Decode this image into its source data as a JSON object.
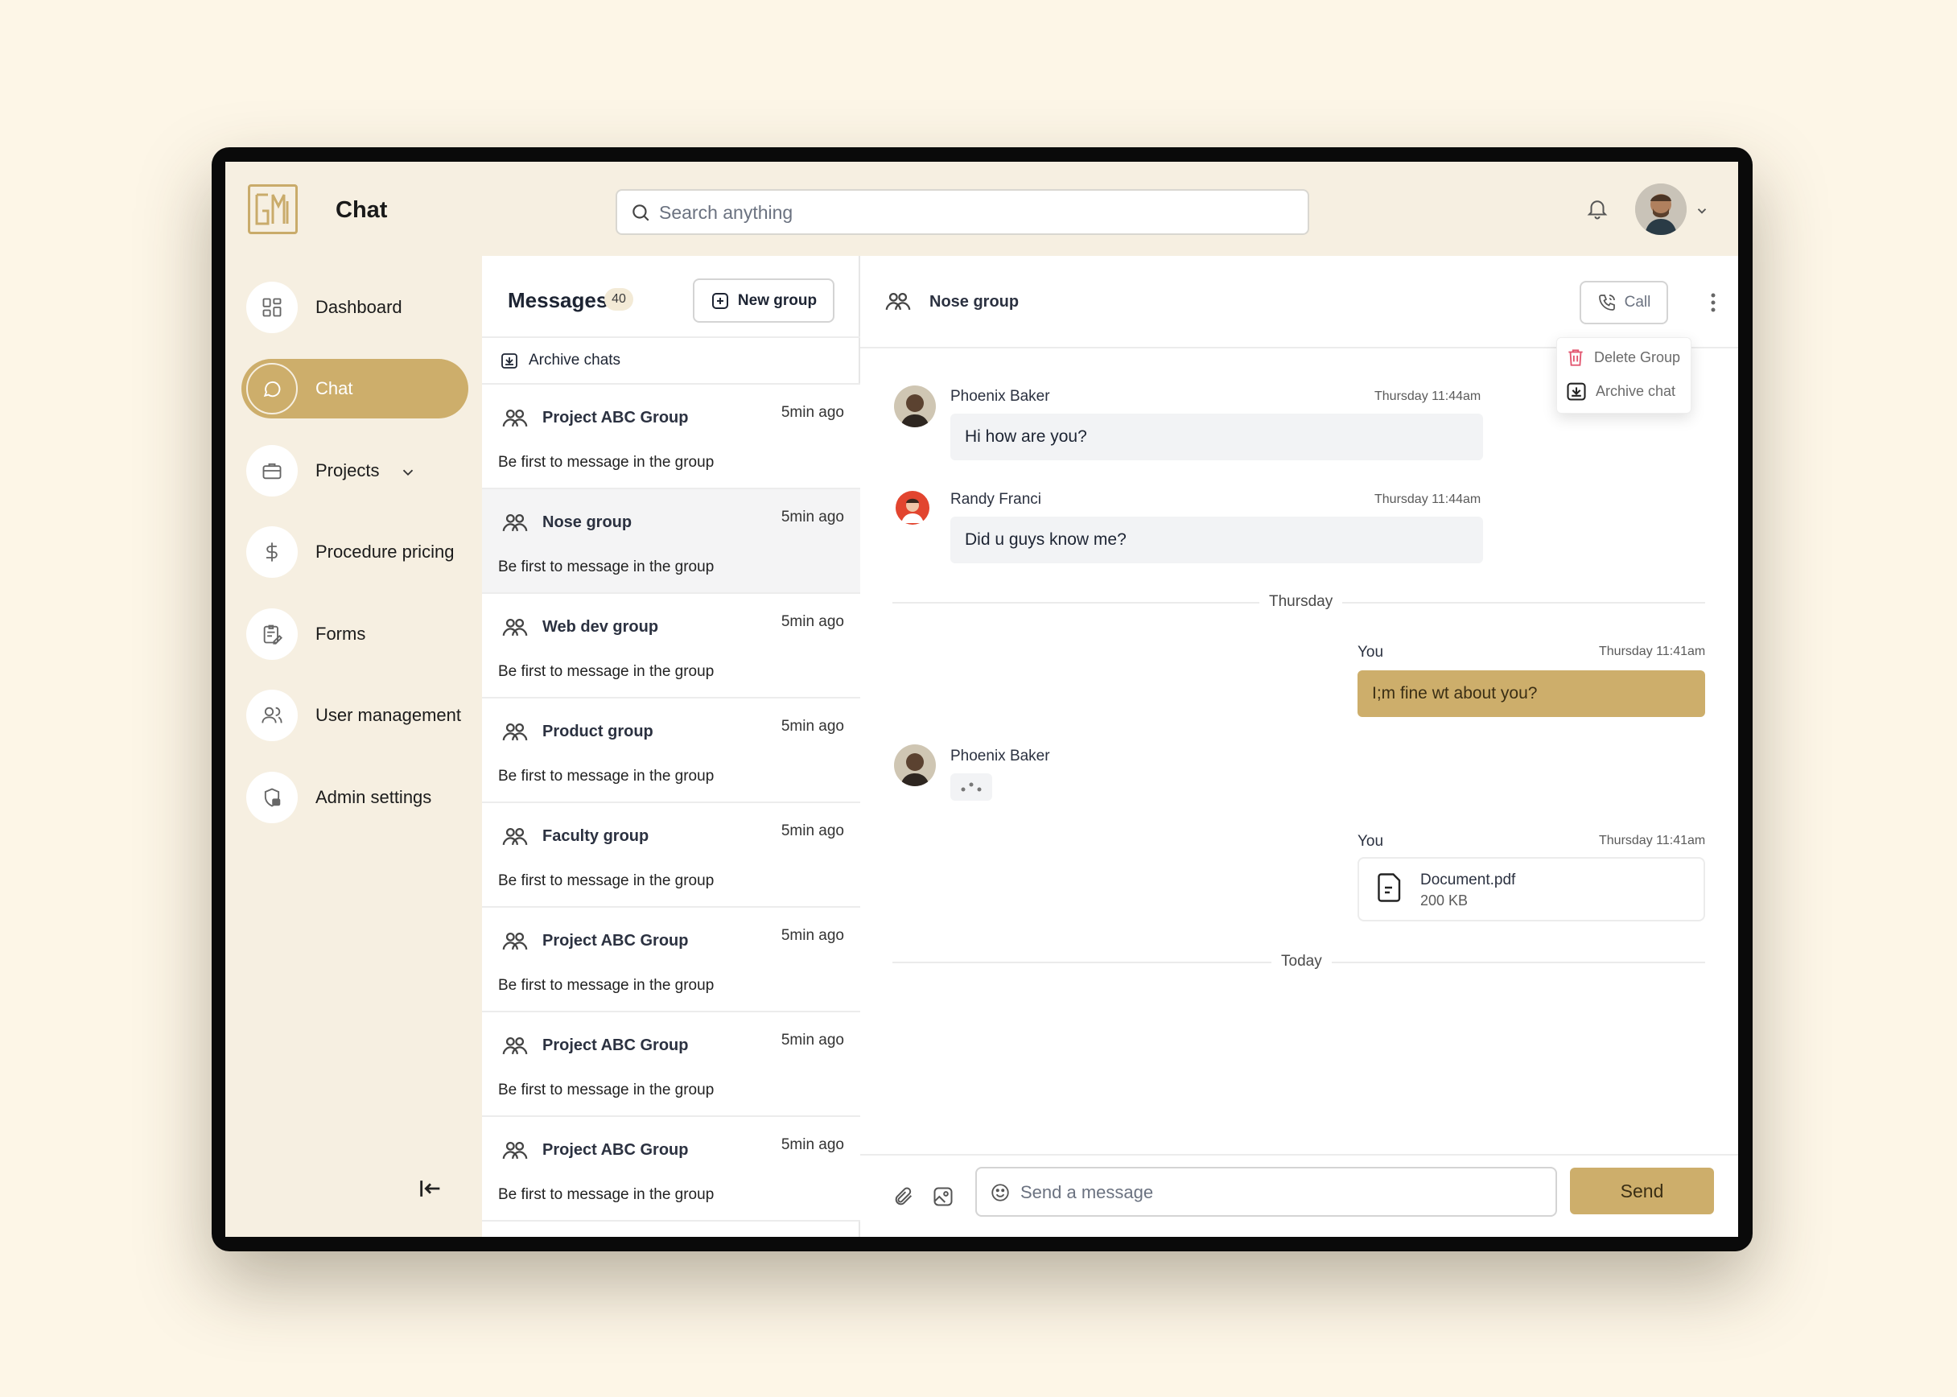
{
  "header": {
    "app_title": "Chat",
    "search_placeholder": "Search anything"
  },
  "sidebar": {
    "items": [
      {
        "label": "Dashboard",
        "icon": "grid-icon"
      },
      {
        "label": "Chat",
        "icon": "chat-bubble-icon",
        "active": true
      },
      {
        "label": "Projects",
        "icon": "briefcase-icon"
      },
      {
        "label": "Procedure pricing",
        "icon": "dollar-icon"
      },
      {
        "label": "Forms",
        "icon": "clipboard-icon"
      },
      {
        "label": "User management",
        "icon": "users-icon"
      },
      {
        "label": "Admin settings",
        "icon": "shield-lock-icon"
      }
    ]
  },
  "messages_panel": {
    "title": "Messages",
    "count": "40",
    "new_group_label": "New group",
    "archive_label": "Archive chats",
    "conversations": [
      {
        "name": "Project ABC Group",
        "time": "5min ago",
        "preview": "Be first to message in the group"
      },
      {
        "name": "Nose group",
        "time": "5min ago",
        "preview": "Be first to message in the group",
        "selected": true
      },
      {
        "name": "Web dev group",
        "time": "5min ago",
        "preview": "Be first to message in the group"
      },
      {
        "name": "Product group",
        "time": "5min ago",
        "preview": "Be first to message in the group"
      },
      {
        "name": "Faculty group",
        "time": "5min ago",
        "preview": "Be first to message in the group"
      },
      {
        "name": "Project ABC Group",
        "time": "5min ago",
        "preview": "Be first to message in the group"
      },
      {
        "name": "Project ABC Group",
        "time": "5min ago",
        "preview": "Be first to message in the group"
      },
      {
        "name": "Project ABC Group",
        "time": "5min ago",
        "preview": "Be first to message in the group"
      }
    ]
  },
  "chat": {
    "group_name": "Nose group",
    "call_label": "Call",
    "menu": {
      "delete_label": "Delete Group",
      "archive_label": "Archive chat"
    },
    "messages": [
      {
        "sender": "Phoenix Baker",
        "time": "Thursday 11:44am",
        "text": "Hi how are you?"
      },
      {
        "sender": "Randy Franci",
        "time": "Thursday 11:44am",
        "text": "Did u guys know me?"
      },
      {
        "sender": "You",
        "time": "Thursday 11:41am",
        "text": "I;m fine wt about you?"
      },
      {
        "sender": "Phoenix Baker"
      },
      {
        "sender": "You",
        "time": "Thursday 11:41am",
        "file_name": "Document.pdf",
        "file_size": "200 KB"
      }
    ],
    "dividers": [
      "Thursday",
      "Today"
    ],
    "composer_placeholder": "Send a message",
    "send_label": "Send"
  },
  "colors": {
    "accent": "#cdae6b",
    "panel_bg": "#f6efe1",
    "page_bg": "#fdf6e7"
  }
}
